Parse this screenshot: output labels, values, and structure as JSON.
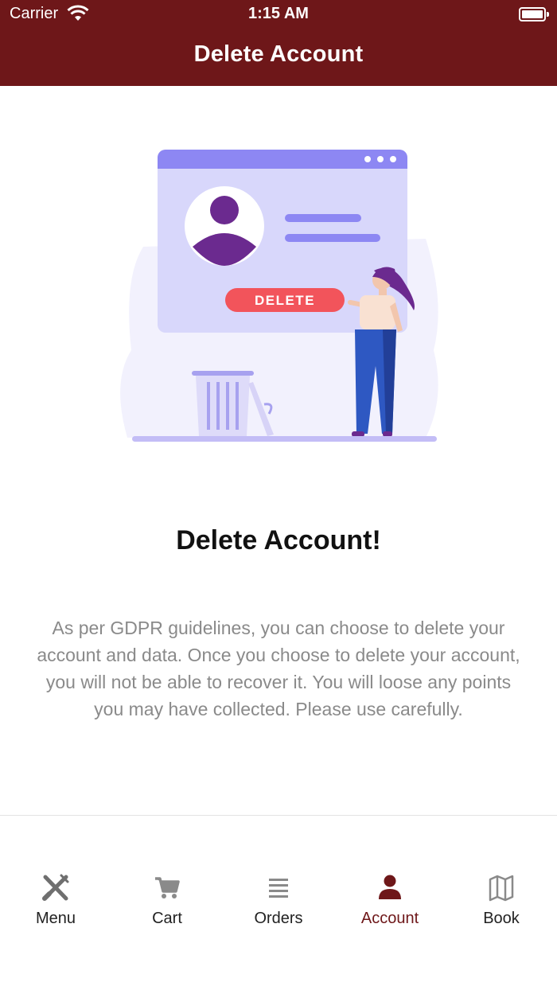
{
  "status_bar": {
    "carrier": "Carrier",
    "time": "1:15 AM"
  },
  "nav": {
    "title": "Delete Account"
  },
  "illustration": {
    "button_text": "DELETE"
  },
  "content": {
    "heading": "Delete Account!",
    "description": "As per GDPR guidelines, you can choose to delete your account and data. Once you choose to delete your account, you will not be able to recover it. You will loose any points you may have collected. Please use carefully."
  },
  "tabbar": {
    "items": [
      {
        "label": "Menu",
        "icon": "utensils-icon"
      },
      {
        "label": "Cart",
        "icon": "cart-icon"
      },
      {
        "label": "Orders",
        "icon": "list-icon"
      },
      {
        "label": "Account",
        "icon": "user-icon",
        "active": true
      },
      {
        "label": "Book",
        "icon": "map-icon"
      }
    ]
  },
  "colors": {
    "brand": "#6e1719",
    "inactive": "#222222",
    "muted_text": "#8a8a8a"
  }
}
